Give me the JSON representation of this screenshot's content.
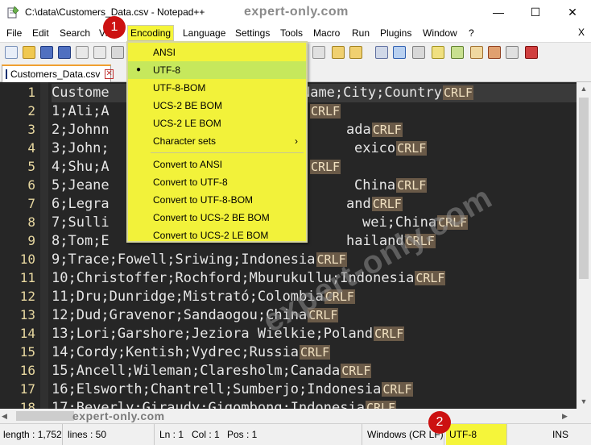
{
  "window": {
    "title": "C:\\data\\Customers_Data.csv - Notepad++",
    "minimize_glyph": "—",
    "maximize_glyph": "☐",
    "close_glyph": "✕"
  },
  "watermarks": {
    "top": "expert-only.com",
    "diagonal": "expert-only.com",
    "scrollbar": "expert-only.com"
  },
  "menubar": {
    "items": [
      {
        "label": "File"
      },
      {
        "label": "Edit"
      },
      {
        "label": "Search"
      },
      {
        "label": "Vi"
      },
      {
        "label": "Encoding"
      },
      {
        "label": "Language"
      },
      {
        "label": "Settings"
      },
      {
        "label": "Tools"
      },
      {
        "label": "Macro"
      },
      {
        "label": "Run"
      },
      {
        "label": "Plugins"
      },
      {
        "label": "Window"
      },
      {
        "label": "?"
      }
    ],
    "close_label": "X"
  },
  "tab": {
    "label": "Customers_Data.csv",
    "close_glyph": "✕"
  },
  "encoding_menu": {
    "items": [
      {
        "label": "ANSI"
      },
      {
        "label": "UTF-8",
        "checked": true
      },
      {
        "label": "UTF-8-BOM"
      },
      {
        "label": "UCS-2 BE BOM"
      },
      {
        "label": "UCS-2 LE BOM"
      },
      {
        "label": "Character sets",
        "has_submenu": true
      },
      {
        "label": "Convert to ANSI"
      },
      {
        "label": "Convert to UTF-8"
      },
      {
        "label": "Convert to UTF-8-BOM"
      },
      {
        "label": "Convert to UCS-2 BE BOM"
      },
      {
        "label": "Convert to UCS-2 LE BOM"
      }
    ],
    "bullet": "●",
    "submenu_arrow": "›"
  },
  "editor": {
    "crlf": "CRLF",
    "lines": [
      {
        "num": "1",
        "text": "Custome",
        "tail": "Name;City;Country"
      },
      {
        "num": "2",
        "text": "1;Ali;A",
        "tail": ""
      },
      {
        "num": "3",
        "text": "2;Johnn",
        "tail": "ada"
      },
      {
        "num": "4",
        "text": "3;John;",
        "tail": "exico"
      },
      {
        "num": "5",
        "text": "4;Shu;A",
        "tail": ""
      },
      {
        "num": "6",
        "text": "5;Jeane",
        "tail": "China"
      },
      {
        "num": "7",
        "text": "6;Legra",
        "tail": "and"
      },
      {
        "num": "8",
        "text": "7;Sulli",
        "tail": "wei;China"
      },
      {
        "num": "9",
        "text": "8;Tom;E",
        "tail": "hailand"
      },
      {
        "num": "10",
        "text": "9;Trace;Fowell;Sriwing;Indonesia",
        "tail": null
      },
      {
        "num": "11",
        "text": "10;Christoffer;Rochford;Mburukullu;Indonesia",
        "tail": null
      },
      {
        "num": "12",
        "text": "11;Dru;Dunridge;Mistrató;Colombia",
        "tail": null
      },
      {
        "num": "13",
        "text": "12;Dud;Gravenor;Sandaogou;China",
        "tail": null
      },
      {
        "num": "14",
        "text": "13;Lori;Garshore;Jeziora Wielkie;Poland",
        "tail": null
      },
      {
        "num": "15",
        "text": "14;Cordy;Kentish;Vydrec;Russia",
        "tail": null
      },
      {
        "num": "16",
        "text": "15;Ancell;Wileman;Claresholm;Canada",
        "tail": null
      },
      {
        "num": "17",
        "text": "16;Elsworth;Chantrell;Sumberjo;Indonesia",
        "tail": null
      },
      {
        "num": "18",
        "text": "17;Beverly;Giraudy;Gigombong;Indonesia",
        "tail": null
      }
    ]
  },
  "statusbar": {
    "length": "length : 1,752",
    "lines": "lines : 50",
    "ln": "Ln : 1",
    "col": "Col : 1",
    "pos": "Pos : 1",
    "eol": "Windows (CR LF)",
    "encoding": "UTF-8",
    "mode": "INS"
  },
  "callouts": {
    "first": "1",
    "second": "2"
  },
  "colors": {
    "highlight_yellow": "#f5f53a",
    "selected_green": "#c6e85c",
    "editor_bg": "#262626",
    "callout_red": "#cc1111"
  }
}
